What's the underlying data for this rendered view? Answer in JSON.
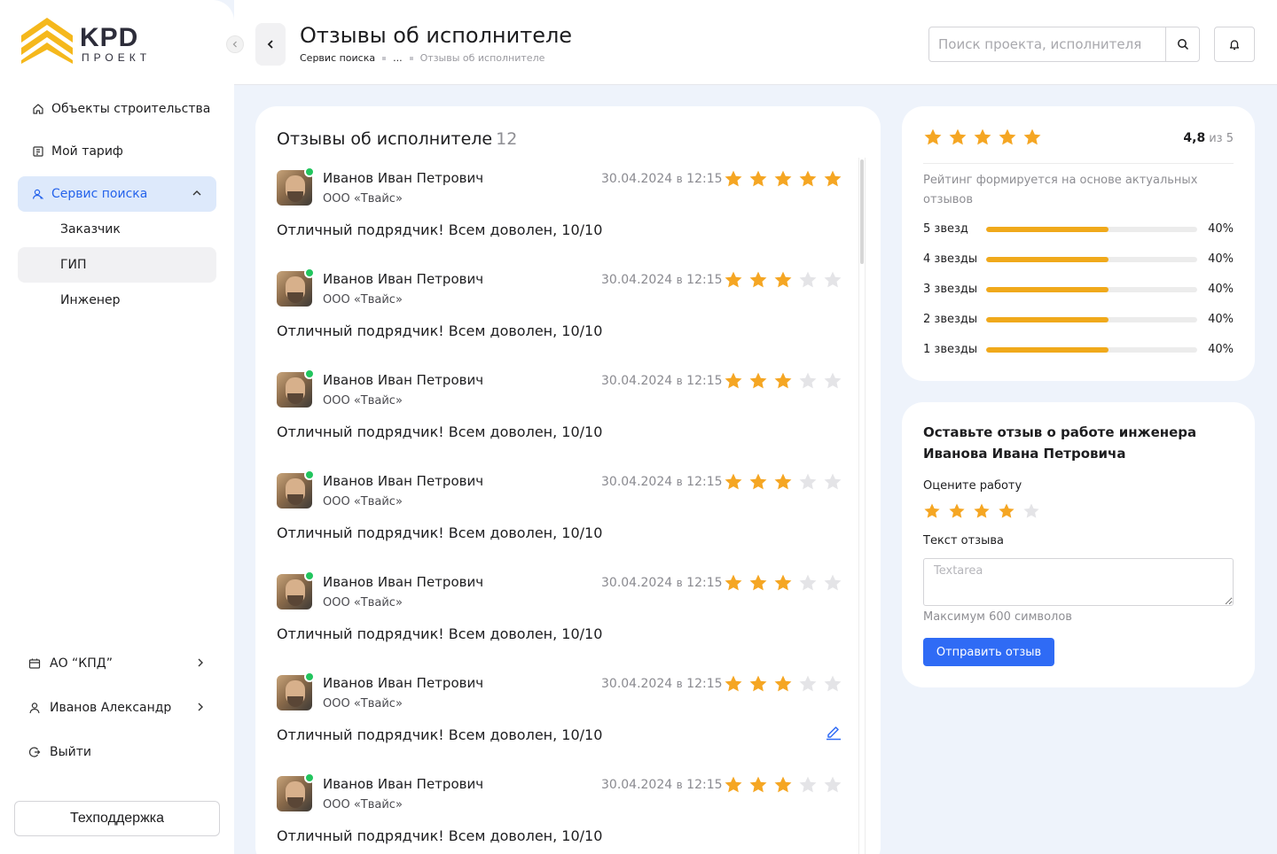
{
  "brand": {
    "name": "KPD",
    "sub": "ПРОЕКТ",
    "accent": "#f5b81c"
  },
  "sidebar": {
    "items": [
      {
        "label": "Объекты строительства",
        "icon": "home-icon"
      },
      {
        "label": "Мой тариф",
        "icon": "tariff-icon"
      },
      {
        "label": "Сервис поиска",
        "icon": "search-people-icon",
        "active": true,
        "expanded": true
      }
    ],
    "subitems": [
      {
        "label": "Заказчик"
      },
      {
        "label": "ГИП",
        "selected": true
      },
      {
        "label": "Инженер"
      }
    ],
    "bottom": [
      {
        "label": "АО “КПД”",
        "icon": "company-icon"
      },
      {
        "label": "Иванов Александр",
        "icon": "user-icon"
      },
      {
        "label": "Выйти",
        "icon": "logout-icon"
      }
    ],
    "support_label": "Техподдержка"
  },
  "header": {
    "title": "Отзывы об исполнителе",
    "breadcrumb": [
      "Сервис поиска",
      "...",
      "Отзывы об исполнителе"
    ],
    "search_placeholder": "Поиск проекта, исполнителя"
  },
  "reviews": {
    "title": "Отзывы об исполнителе",
    "count": "12",
    "items": [
      {
        "name": "Иванов Иван Петрович",
        "company": "ООО «Твайс»",
        "date": "30.04.2024",
        "at": "в",
        "time": "12:15",
        "rating": 5,
        "text": "Отличный подрядчик! Всем доволен, 10/10"
      },
      {
        "name": "Иванов Иван Петрович",
        "company": "ООО «Твайс»",
        "date": "30.04.2024",
        "at": "в",
        "time": "12:15",
        "rating": 3,
        "text": "Отличный подрядчик! Всем доволен, 10/10"
      },
      {
        "name": "Иванов Иван Петрович",
        "company": "ООО «Твайс»",
        "date": "30.04.2024",
        "at": "в",
        "time": "12:15",
        "rating": 3,
        "text": "Отличный подрядчик! Всем доволен, 10/10"
      },
      {
        "name": "Иванов Иван Петрович",
        "company": "ООО «Твайс»",
        "date": "30.04.2024",
        "at": "в",
        "time": "12:15",
        "rating": 3,
        "text": "Отличный подрядчик! Всем доволен, 10/10"
      },
      {
        "name": "Иванов Иван Петрович",
        "company": "ООО «Твайс»",
        "date": "30.04.2024",
        "at": "в",
        "time": "12:15",
        "rating": 3,
        "text": "Отличный подрядчик! Всем доволен, 10/10"
      },
      {
        "name": "Иванов Иван Петрович",
        "company": "ООО «Твайс»",
        "date": "30.04.2024",
        "at": "в",
        "time": "12:15",
        "rating": 3,
        "text": "Отличный подрядчик! Всем доволен, 10/10",
        "editable": true
      },
      {
        "name": "Иванов Иван Петрович",
        "company": "ООО «Твайс»",
        "date": "30.04.2024",
        "at": "в",
        "time": "12:15",
        "rating": 3,
        "text": "Отличный подрядчик! Всем доволен, 10/10"
      }
    ]
  },
  "rating": {
    "stars": 5,
    "score": "4,8",
    "of_label": "из 5",
    "note": "Рейтинг формируется на основе актуальных отзывов",
    "bars": [
      {
        "label": "5 звезд",
        "percent": 40,
        "pct_label": "40%"
      },
      {
        "label": "4 звезды",
        "percent": 40,
        "pct_label": "40%"
      },
      {
        "label": "3 звезды",
        "percent": 40,
        "pct_label": "40%"
      },
      {
        "label": "2 звезды",
        "percent": 40,
        "pct_label": "40%"
      },
      {
        "label": "1 звезды",
        "percent": 40,
        "pct_label": "40%"
      }
    ]
  },
  "feedback": {
    "title": "Оставьте отзыв о работе инженера Иванова Ивана Петровича",
    "rate_label": "Оцените работу",
    "rating": 4,
    "text_label": "Текст отзыва",
    "placeholder": "Textarea",
    "hint": "Максимум 600 символов",
    "submit_label": "Отправить отзыв"
  },
  "colors": {
    "star": "#f5a623",
    "star_empty": "#e4e4e7",
    "primary": "#2f6bf5",
    "active_bg": "#dde9fb",
    "online": "#22c55e"
  }
}
